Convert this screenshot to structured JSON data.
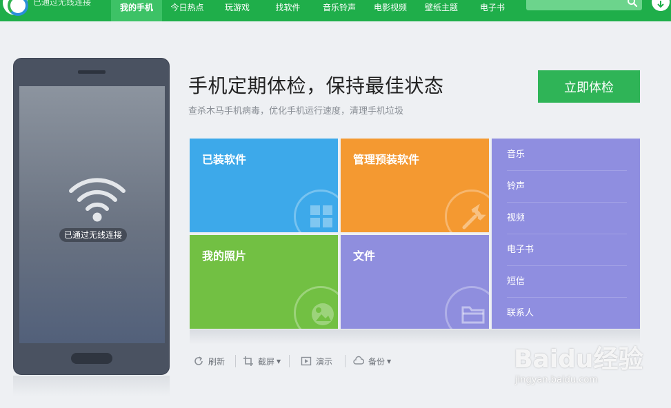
{
  "header": {
    "connection_status": "已通过无线连接",
    "nav": [
      {
        "label": "我的手机",
        "active": true
      },
      {
        "label": "今日热点"
      },
      {
        "label": "玩游戏"
      },
      {
        "label": "找软件"
      },
      {
        "label": "音乐铃声"
      },
      {
        "label": "电影视频"
      },
      {
        "label": "壁纸主题"
      },
      {
        "label": "电子书"
      }
    ],
    "search": {
      "placeholder": "",
      "icon": "search-icon"
    },
    "download_icon": "download-icon"
  },
  "phone": {
    "status_label": "已通过无线连接",
    "icon": "wifi-icon"
  },
  "main": {
    "headline": "手机定期体检，保持最佳状态",
    "subtitle": "查杀木马手机病毒，优化手机运行速度，清理手机垃圾",
    "check_button": "立即体检"
  },
  "tiles": [
    {
      "title": "已装软件",
      "icon": "apps-grid-icon",
      "color": "#3da9ea"
    },
    {
      "title": "管理预装软件",
      "icon": "wrench-icon",
      "color": "#f49931"
    },
    {
      "title": "我的照片",
      "icon": "photo-icon",
      "color": "#72c043"
    },
    {
      "title": "文件",
      "icon": "folder-icon",
      "color": "#8f8ede"
    }
  ],
  "media_list": [
    "音乐",
    "铃声",
    "视频",
    "电子书",
    "短信",
    "联系人"
  ],
  "toolbar": {
    "refresh": "刷新",
    "screenshot": "截屏",
    "demo": "演示",
    "backup": "备份"
  },
  "watermark": {
    "logo": "Baidu经验",
    "url": "jingyan.baidu.com"
  },
  "colors": {
    "brand_green": "#1fae4a",
    "button_green": "#2fb457"
  }
}
